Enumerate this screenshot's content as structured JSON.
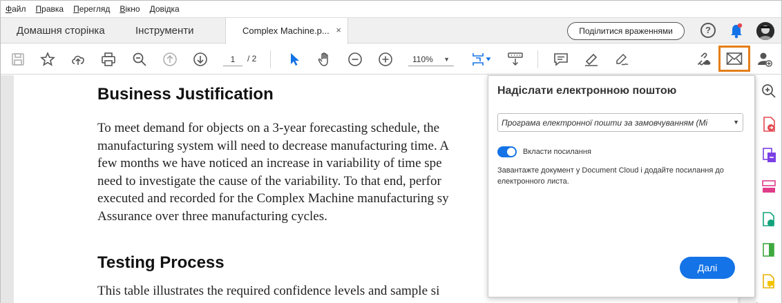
{
  "menu": [
    "Файл",
    "Правка",
    "Перегляд",
    "Вікно",
    "Довідка"
  ],
  "tabs": {
    "home": "Домашня сторінка",
    "tools": "Інструменти",
    "document": "Complex Machine.p...",
    "close_glyph": "×"
  },
  "header": {
    "share_feedback": "Поділитися враженнями",
    "help_glyph": "?"
  },
  "toolbar": {
    "page_current": "1",
    "page_total": "/  2",
    "zoom": "110%",
    "icons": [
      "save-icon",
      "bookmark-star-icon",
      "upload-cloud-icon",
      "print-icon",
      "search-zoom-icon",
      "page-up-icon",
      "page-down-icon",
      "select-arrow-icon",
      "hand-icon",
      "zoom-out-icon",
      "zoom-in-icon",
      "fit-page-icon",
      "scroll-mode-icon",
      "comment-icon",
      "highlight-icon",
      "sign-icon",
      "link-share-icon",
      "email-icon",
      "add-user-icon"
    ]
  },
  "document": {
    "heading1": "Business Justification",
    "paragraph1": [
      "To meet demand for objects on a 3-year forecasting schedule, the",
      "manufacturing system will need to decrease manufacturing time. A",
      "few months we have noticed an increase in variability of time spe",
      "need to investigate the cause of the variability. To that end, perfor",
      "executed and recorded for the Complex Machine manufacturing sy",
      "Assurance over three manufacturing cycles."
    ],
    "heading2": "Testing Process",
    "paragraph2": "This table illustrates the required confidence levels and sample si"
  },
  "email_popup": {
    "title": "Надіслати електронною поштою",
    "email_app": "Програма електронної пошти за замовчуванням (Mi",
    "attach_link_label": "Вкласти посилання",
    "attach_link_on": true,
    "description": "Завантажте документ у Document Cloud і додайте посилання до електронного листа.",
    "next_button": "Далі"
  },
  "colors": {
    "accent_blue": "#1473e6",
    "highlight_orange": "#e47e18",
    "notification_red": "#e34850"
  }
}
